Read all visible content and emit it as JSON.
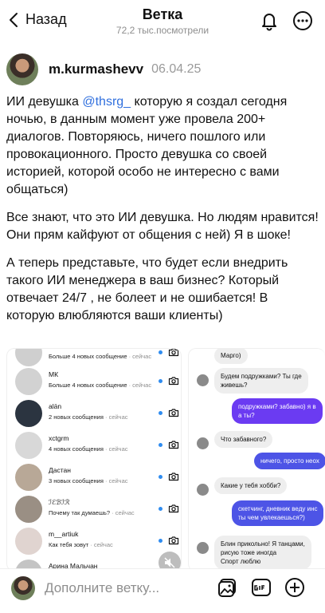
{
  "header": {
    "back_label": "Назад",
    "title": "Ветка",
    "subtitle": "72,2 тыс.посмотрели"
  },
  "post": {
    "author": "m.kurmashevv",
    "date": "06.04.25",
    "p1_before": "ИИ девушка ",
    "p1_mention": "@thsrg_",
    "p1_after": " которую я создал сегодня ночью, в данным момент уже провела 200+ диалогов. Повторяюсь, ничего пошлого или провокационного. Просто девушка со своей историей, которой особо не интересно с вами общаться)",
    "p2": "Все знают, что это ИИ девушка. Но людям нравится! Они прям кайфуют от общения с ней) Я в шоке!",
    "p3": "А теперь представьте, что будет если внедрить такого ИИ менеджера в ваш бизнес? Который отвечает 24/7 , не болеет и не ошибается! В которую влюбляются ваши клиенты)"
  },
  "dm_list": [
    {
      "name": "",
      "message": "Больше 4 новых сообщение",
      "time": " · сейчас"
    },
    {
      "name": "МК",
      "message": "Больше 4 новых сообщение",
      "time": " · сейчас"
    },
    {
      "name": "alän",
      "message": "2 новых сообщения",
      "time": " · сейчас"
    },
    {
      "name": "xctgrm",
      "message": "4 новых сообщения",
      "time": " · сейчас"
    },
    {
      "name": "Дастан",
      "message": "3 новых сообщения",
      "time": " · сейчас"
    },
    {
      "name": "ℐℰℬℐℛ",
      "message": "Почему так думаешь?",
      "time": " · сейчас"
    },
    {
      "name": "m__artiuk",
      "message": "Как тебя зовут",
      "time": " · сейчас"
    },
    {
      "name": "Арина Мальчан",
      "message": "",
      "time": ""
    }
  ],
  "chat": {
    "messages": [
      {
        "dir": "in",
        "text": "Марго)"
      },
      {
        "dir": "in",
        "text": "Будем подружками? Ты где\nживешь?"
      },
      {
        "dir": "out",
        "text": "подружками? забавно) я в\nа ты?"
      },
      {
        "dir": "in",
        "text": "Что забавного?"
      },
      {
        "dir": "out",
        "text": "ничего, просто неох"
      },
      {
        "dir": "in",
        "text": "Какие у тебя хобби?"
      },
      {
        "dir": "out",
        "text": "скетчинг, дневник веду инс\nты чем увлекаешься?)"
      },
      {
        "dir": "in",
        "text": "Блин прикольно! Я танцами,\nрисую тоже иногда\nСпорт люблю"
      }
    ]
  },
  "composer": {
    "placeholder": "Дополните ветку..."
  },
  "colors": {
    "accent_blue": "#2f6fde",
    "unread_dot": "#2f8cf0",
    "bubble_out": "#6b3bf2",
    "bubble_out_2": "#4d54e6"
  }
}
